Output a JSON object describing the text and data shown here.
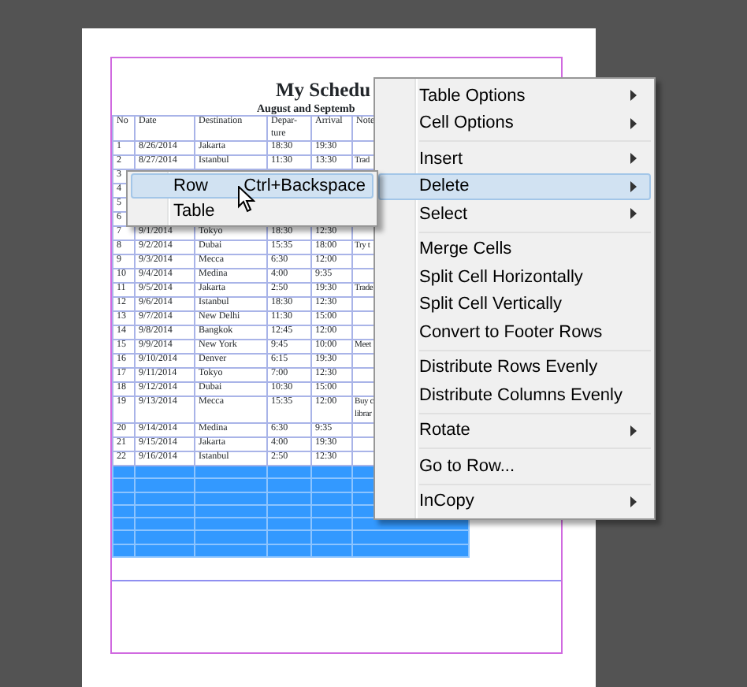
{
  "document": {
    "title": "My Schedu",
    "subtitle": "August and Septemb",
    "columns": [
      "No",
      "Date",
      "Destination",
      "Depar-\nture",
      "Arrival",
      "Note"
    ],
    "rows": [
      {
        "no": "1",
        "date": "8/26/2014",
        "destination": "Jakarta",
        "departure": "18:30",
        "arrival": "19:30"
      },
      {
        "no": "2",
        "date": "8/27/2014",
        "destination": "Istanbul",
        "departure": "11:30",
        "arrival": "13:30",
        "note": "Trad"
      },
      {
        "no": "3"
      },
      {
        "no": "4"
      },
      {
        "no": "5"
      },
      {
        "no": "6"
      },
      {
        "no": "7",
        "date": "9/1/2014",
        "destination": "Tokyo",
        "departure": "18:30",
        "arrival": "12:30"
      },
      {
        "no": "8",
        "date": "9/2/2014",
        "destination": "Dubai",
        "departure": "15:35",
        "arrival": "18:00",
        "note": "Try t"
      },
      {
        "no": "9",
        "date": "9/3/2014",
        "destination": "Mecca",
        "departure": "6:30",
        "arrival": "12:00"
      },
      {
        "no": "10",
        "date": "9/4/2014",
        "destination": "Medina",
        "departure": "4:00",
        "arrival": "9:35"
      },
      {
        "no": "11",
        "date": "9/5/2014",
        "destination": "Jakarta",
        "departure": "2:50",
        "arrival": "19:30",
        "note": "Trade"
      },
      {
        "no": "12",
        "date": "9/6/2014",
        "destination": "Istanbul",
        "departure": "18:30",
        "arrival": "12:30"
      },
      {
        "no": "13",
        "date": "9/7/2014",
        "destination": "New Delhi",
        "departure": "11:30",
        "arrival": "15:00"
      },
      {
        "no": "14",
        "date": "9/8/2014",
        "destination": "Bangkok",
        "departure": "12:45",
        "arrival": "12:00"
      },
      {
        "no": "15",
        "date": "9/9/2014",
        "destination": "New York",
        "departure": "9:45",
        "arrival": "10:00",
        "note": "Meet"
      },
      {
        "no": "16",
        "date": "9/10/2014",
        "destination": "Denver",
        "departure": "6:15",
        "arrival": "19:30"
      },
      {
        "no": "17",
        "date": "9/11/2014",
        "destination": "Tokyo",
        "departure": "7:00",
        "arrival": "12:30"
      },
      {
        "no": "18",
        "date": "9/12/2014",
        "destination": "Dubai",
        "departure": "10:30",
        "arrival": "15:00"
      },
      {
        "no": "19",
        "date": "9/13/2014",
        "destination": "Mecca",
        "departure": "15:35",
        "arrival": "12:00",
        "note": "Buy c\nlibrar"
      },
      {
        "no": "20",
        "date": "9/14/2014",
        "destination": "Medina",
        "departure": "6:30",
        "arrival": "9:35"
      },
      {
        "no": "21",
        "date": "9/15/2014",
        "destination": "Jakarta",
        "departure": "4:00",
        "arrival": "19:30"
      },
      {
        "no": "22",
        "date": "9/16/2014",
        "destination": "Istanbul",
        "departure": "2:50",
        "arrival": "12:30"
      }
    ],
    "blank_rows": [
      {
        "selected": true
      },
      {
        "selected": true
      },
      {
        "selected": true
      },
      {
        "selected": true
      },
      {
        "selected": true
      },
      {
        "selected": true
      },
      {
        "selected": true
      }
    ]
  },
  "context_menu": {
    "groups": [
      {
        "items": [
          {
            "label": "Table Options",
            "submenu": true,
            "selected": false
          },
          {
            "label": "Cell Options",
            "submenu": true,
            "selected": false
          }
        ]
      },
      {
        "items": [
          {
            "label": "Insert",
            "submenu": true,
            "selected": false
          },
          {
            "label": "Delete",
            "submenu": true,
            "selected": true
          },
          {
            "label": "Select",
            "submenu": true,
            "selected": false
          }
        ]
      },
      {
        "items": [
          {
            "label": "Merge Cells",
            "submenu": false,
            "selected": false
          },
          {
            "label": "Split Cell Horizontally",
            "submenu": false,
            "selected": false
          },
          {
            "label": "Split Cell Vertically",
            "submenu": false,
            "selected": false
          },
          {
            "label": "Convert to Footer Rows",
            "submenu": false,
            "selected": false
          }
        ]
      },
      {
        "items": [
          {
            "label": "Distribute Rows Evenly",
            "submenu": false,
            "selected": false
          },
          {
            "label": "Distribute Columns Evenly",
            "submenu": false,
            "selected": false
          }
        ]
      },
      {
        "items": [
          {
            "label": "Rotate",
            "submenu": true,
            "selected": false
          }
        ]
      },
      {
        "items": [
          {
            "label": "Go to Row...",
            "submenu": false,
            "selected": false
          }
        ]
      },
      {
        "items": [
          {
            "label": "InCopy",
            "submenu": true,
            "selected": false
          }
        ]
      }
    ]
  },
  "submenu": {
    "items": [
      {
        "label": "Row",
        "shortcut": "Ctrl+Backspace",
        "selected": true
      },
      {
        "label": "Table",
        "selected": false
      }
    ]
  }
}
